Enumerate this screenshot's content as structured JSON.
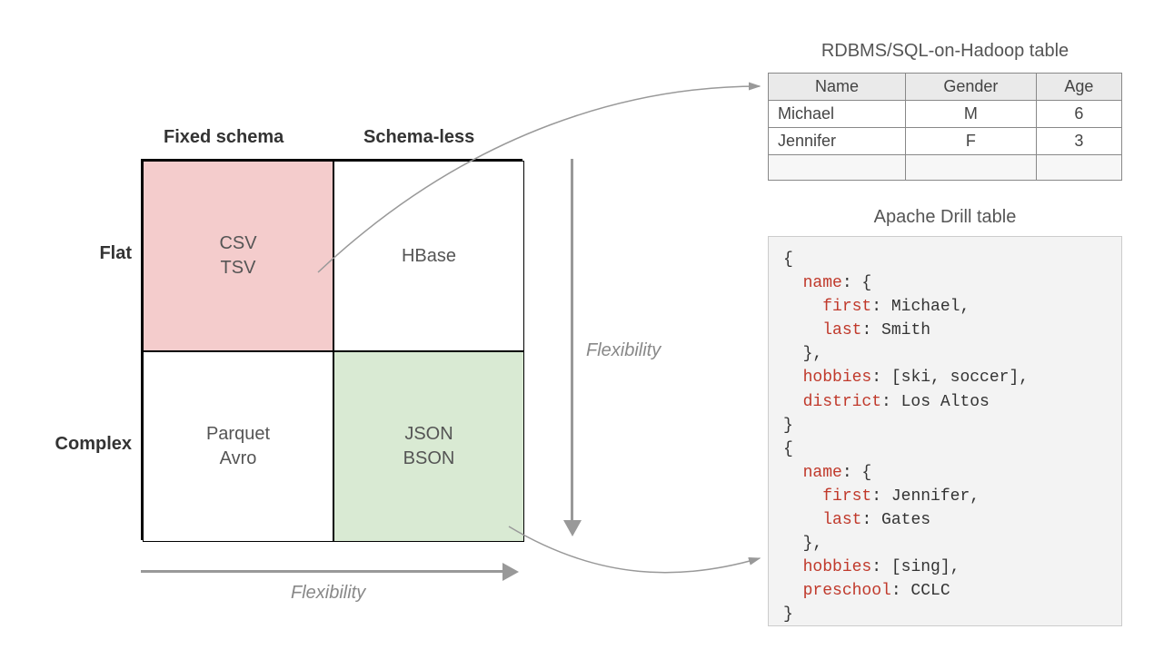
{
  "quadrant": {
    "col_headers": [
      "Fixed schema",
      "Schema-less"
    ],
    "row_headers": [
      "Flat",
      "Complex"
    ],
    "cells": {
      "tl": "CSV\nTSV",
      "tr": "HBase",
      "bl": "Parquet\nAvro",
      "br": "JSON\nBSON"
    },
    "axis_label_h": "Flexibility",
    "axis_label_v": "Flexibility"
  },
  "rdbms": {
    "title": "RDBMS/SQL-on-Hadoop table",
    "headers": [
      "Name",
      "Gender",
      "Age"
    ],
    "rows": [
      [
        "Michael",
        "M",
        "6"
      ],
      [
        "Jennifer",
        "F",
        "3"
      ]
    ]
  },
  "drill": {
    "title": "Apache Drill table",
    "records": [
      {
        "name": {
          "first": "Michael",
          "last": "Smith"
        },
        "extra": [
          [
            "hobbies",
            "[ski, soccer]"
          ],
          [
            "district",
            "Los Altos"
          ]
        ]
      },
      {
        "name": {
          "first": "Jennifer",
          "last": "Gates"
        },
        "extra": [
          [
            "hobbies",
            "[sing]"
          ],
          [
            "preschool",
            "CCLC"
          ]
        ]
      }
    ]
  },
  "colors": {
    "pink": "#F4CCCC",
    "green": "#D9EAD3",
    "arrow": "#999999"
  }
}
